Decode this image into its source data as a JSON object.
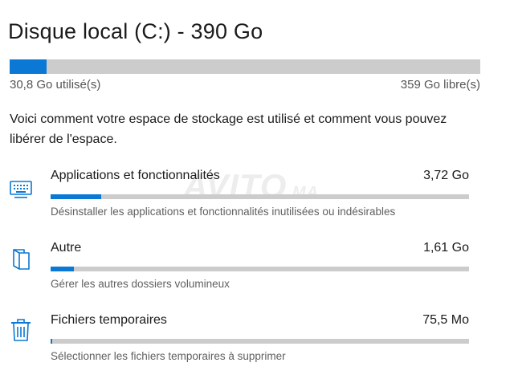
{
  "drive": {
    "title": "Disque local (C:) - 390 Go",
    "used_label": "30,8 Go utilisé(s)",
    "free_label": "359 Go libre(s)",
    "used_fraction": 0.079
  },
  "intro": "Voici comment votre espace de stockage est utilisé et comment vous pouvez libérer de l'espace.",
  "categories": [
    {
      "name": "Applications et fonctionnalités",
      "size": "3,72 Go",
      "description": "Désinstaller les applications et fonctionnalités inutilisées ou indésirables",
      "fill_fraction": 0.12,
      "icon": "apps-keyboard-icon"
    },
    {
      "name": "Autre",
      "size": "1,61 Go",
      "description": "Gérer les autres dossiers volumineux",
      "fill_fraction": 0.055,
      "icon": "folder-icon"
    },
    {
      "name": "Fichiers temporaires",
      "size": "75,5 Mo",
      "description": "Sélectionner les fichiers temporaires à supprimer",
      "fill_fraction": 0.004,
      "icon": "trash-icon"
    }
  ],
  "colors": {
    "accent": "#0a78d4",
    "track": "#cccccc"
  }
}
